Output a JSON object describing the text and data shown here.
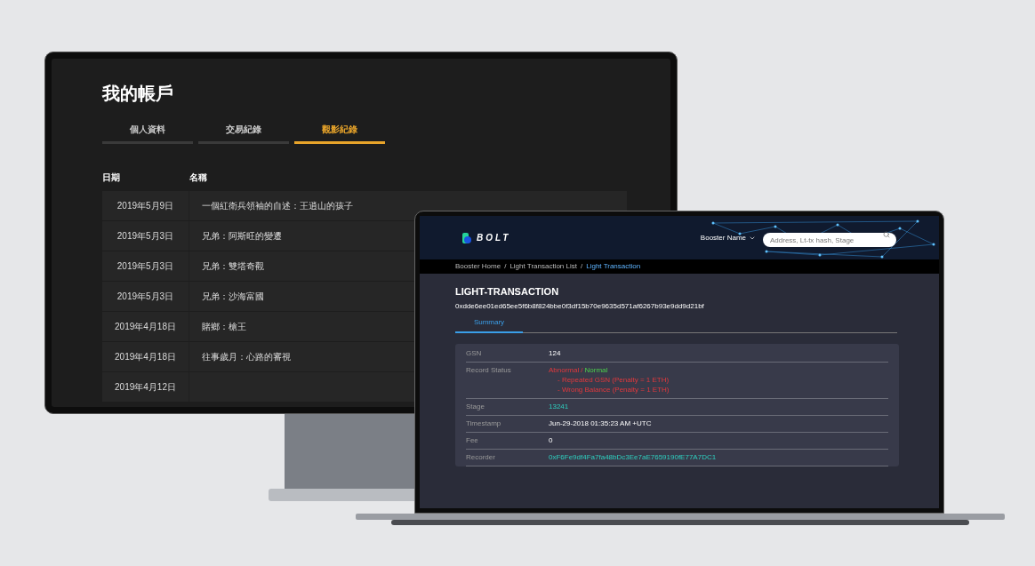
{
  "monitor": {
    "title": "我的帳戶",
    "tabs": [
      {
        "label": "個人資料",
        "selected": false
      },
      {
        "label": "交易紀錄",
        "selected": false
      },
      {
        "label": "觀影紀錄",
        "selected": true
      }
    ],
    "columns": [
      "日期",
      "名稱"
    ],
    "rows": [
      {
        "date": "2019年5月9日",
        "name": "一個紅衛兵領袖的自述：王逍山的孩子"
      },
      {
        "date": "2019年5月3日",
        "name": "兄弟：阿斯旺的變遷"
      },
      {
        "date": "2019年5月3日",
        "name": "兄弟：雙塔奇觀"
      },
      {
        "date": "2019年5月3日",
        "name": "兄弟：沙海富國"
      },
      {
        "date": "2019年4月18日",
        "name": "賭鄉：槍王"
      },
      {
        "date": "2019年4月18日",
        "name": "往事歲月：心路的審視"
      },
      {
        "date": "2019年4月12日"
      }
    ]
  },
  "laptop": {
    "brand": "BOLT",
    "account": "Booster Name",
    "search": {
      "placeholder": "Address, Lt-tx hash, Stage"
    },
    "breadcrumb": [
      {
        "label": "Booster Home",
        "current": false
      },
      {
        "label": "Light Transaction List",
        "current": false
      },
      {
        "label": "Light Transaction",
        "current": true
      }
    ],
    "separator": "/",
    "title": "LIGHT-TRANSACTION",
    "hash": "0xdde6ee01ed65ee5f6b8f824bbe0f3df15b70e9635d571af6267b93e9dd9d21bf",
    "tabs": [
      {
        "label": "Summary",
        "selected": true
      }
    ],
    "details": [
      {
        "kind": "text",
        "label": "GSN",
        "value": "124"
      },
      {
        "kind": "status",
        "label": "Record Status",
        "abnormal": "Abnormal",
        "divider": "/",
        "normal": "Normal",
        "notes": [
          "- Repeated GSN (Penalty = 1 ETH)",
          "- Wrong Balance (Penalty = 1 ETH)"
        ]
      },
      {
        "kind": "link",
        "label": "Stage",
        "value": "13241"
      },
      {
        "kind": "text",
        "label": "Timestamp",
        "value": "Jun-29-2018 01:35:23 AM +UTC"
      },
      {
        "kind": "text",
        "label": "Fee",
        "value": "0"
      },
      {
        "kind": "link",
        "label": "Recorder",
        "value": "0xF6Fe9df4Fa7fa48bDc3Ee7aE7659190fE77A7DC1"
      }
    ]
  }
}
